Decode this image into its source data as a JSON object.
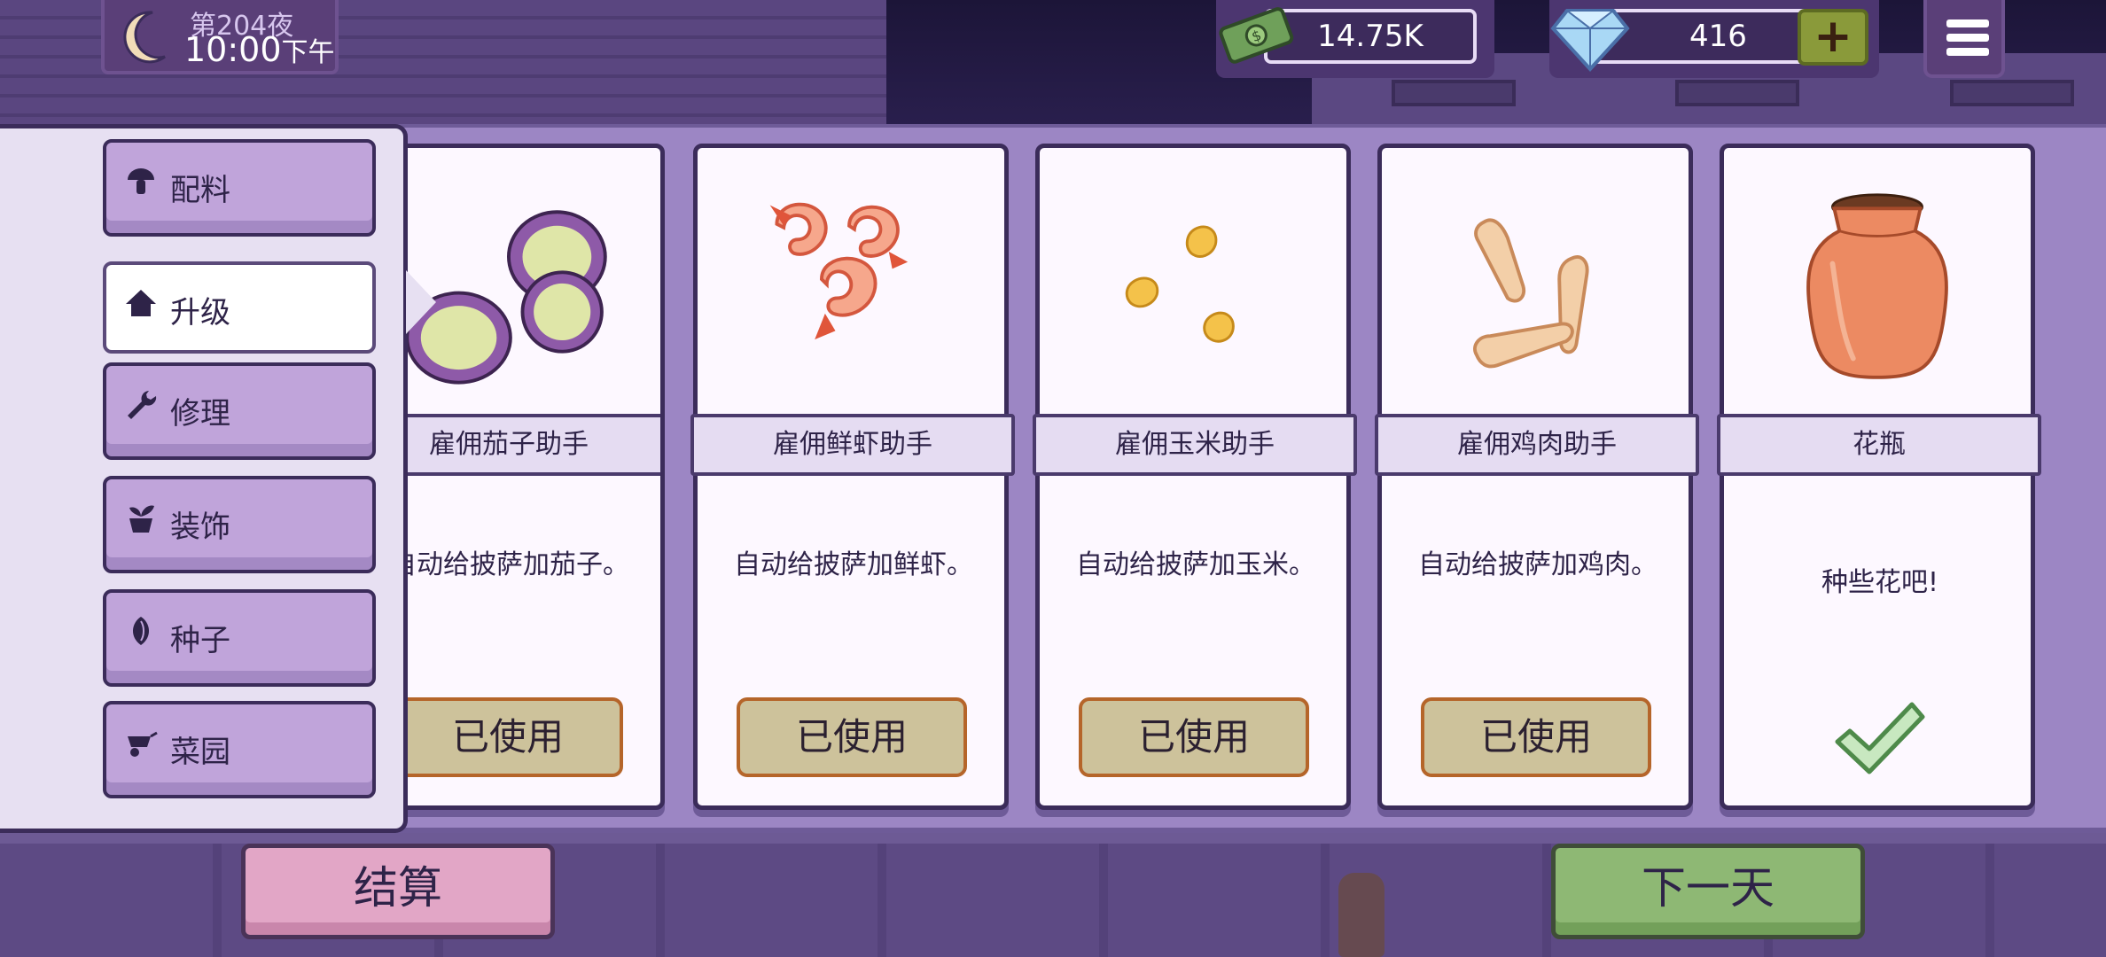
{
  "hud": {
    "day": "第204夜",
    "time": "10:00",
    "time_suffix": "下午",
    "money": "14.75K",
    "gems": "416",
    "plus_label": "+"
  },
  "nav": {
    "items": [
      {
        "label": "配料",
        "icon": "mushroom-icon"
      },
      {
        "label": "升级",
        "icon": "house-icon",
        "active": true
      },
      {
        "label": "修理",
        "icon": "wrench-icon"
      },
      {
        "label": "装饰",
        "icon": "plant-pot-icon"
      },
      {
        "label": "种子",
        "icon": "seed-icon"
      },
      {
        "label": "菜园",
        "icon": "wheelbarrow-icon"
      }
    ]
  },
  "cards": [
    {
      "title": "雇佣茄子助手",
      "desc": "自动给披萨加茄子。",
      "button": "已使用",
      "art": "eggplant-slices"
    },
    {
      "title": "雇佣鲜虾助手",
      "desc": "自动给披萨加鲜虾。",
      "button": "已使用",
      "art": "shrimp"
    },
    {
      "title": "雇佣玉米助手",
      "desc": "自动给披萨加玉米。",
      "button": "已使用",
      "art": "corn-kernels"
    },
    {
      "title": "雇佣鸡肉助手",
      "desc": "自动给披萨加鸡肉。",
      "button": "已使用",
      "art": "chicken-strips"
    },
    {
      "title": "花瓶",
      "desc": "种些花吧!",
      "button": "",
      "art": "vase",
      "owned": true
    }
  ],
  "footer": {
    "settle_label": "结算",
    "next_day_label": "下一天"
  },
  "colors": {
    "panel": "#9c86c4",
    "nav_button": "#c0a4da",
    "used_button": "#cdc29b",
    "settle_button": "#e2a6c6",
    "next_button": "#8eb874"
  }
}
